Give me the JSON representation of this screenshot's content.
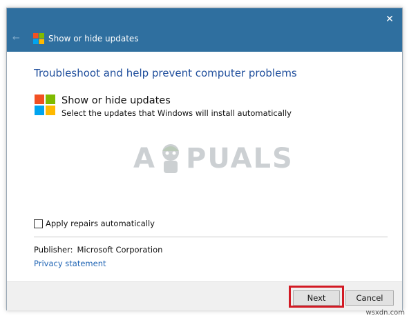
{
  "window": {
    "title": "Show or hide updates",
    "close_glyph": "✕",
    "back_glyph": "←"
  },
  "main": {
    "heading": "Troubleshoot and help prevent computer problems",
    "tool_title": "Show or hide updates",
    "tool_description": "Select the updates that Windows will install automatically"
  },
  "options": {
    "apply_repairs_label": "Apply repairs automatically",
    "apply_repairs_checked": false
  },
  "info": {
    "publisher_label": "Publisher:",
    "publisher_name": "Microsoft Corporation",
    "privacy_link": "Privacy statement"
  },
  "buttons": {
    "next": "Next",
    "cancel": "Cancel"
  },
  "watermark": {
    "left_text": "A",
    "right_text": "PUALS"
  },
  "site_watermark": "wsxdn.com",
  "colors": {
    "titlebar": "#2f6f9f",
    "heading": "#1f4e9c",
    "link": "#1f64b4",
    "highlight": "#d21a24",
    "logo_red": "#f25022",
    "logo_green": "#7fba00",
    "logo_blue": "#00a4ef",
    "logo_yellow": "#ffb900"
  }
}
